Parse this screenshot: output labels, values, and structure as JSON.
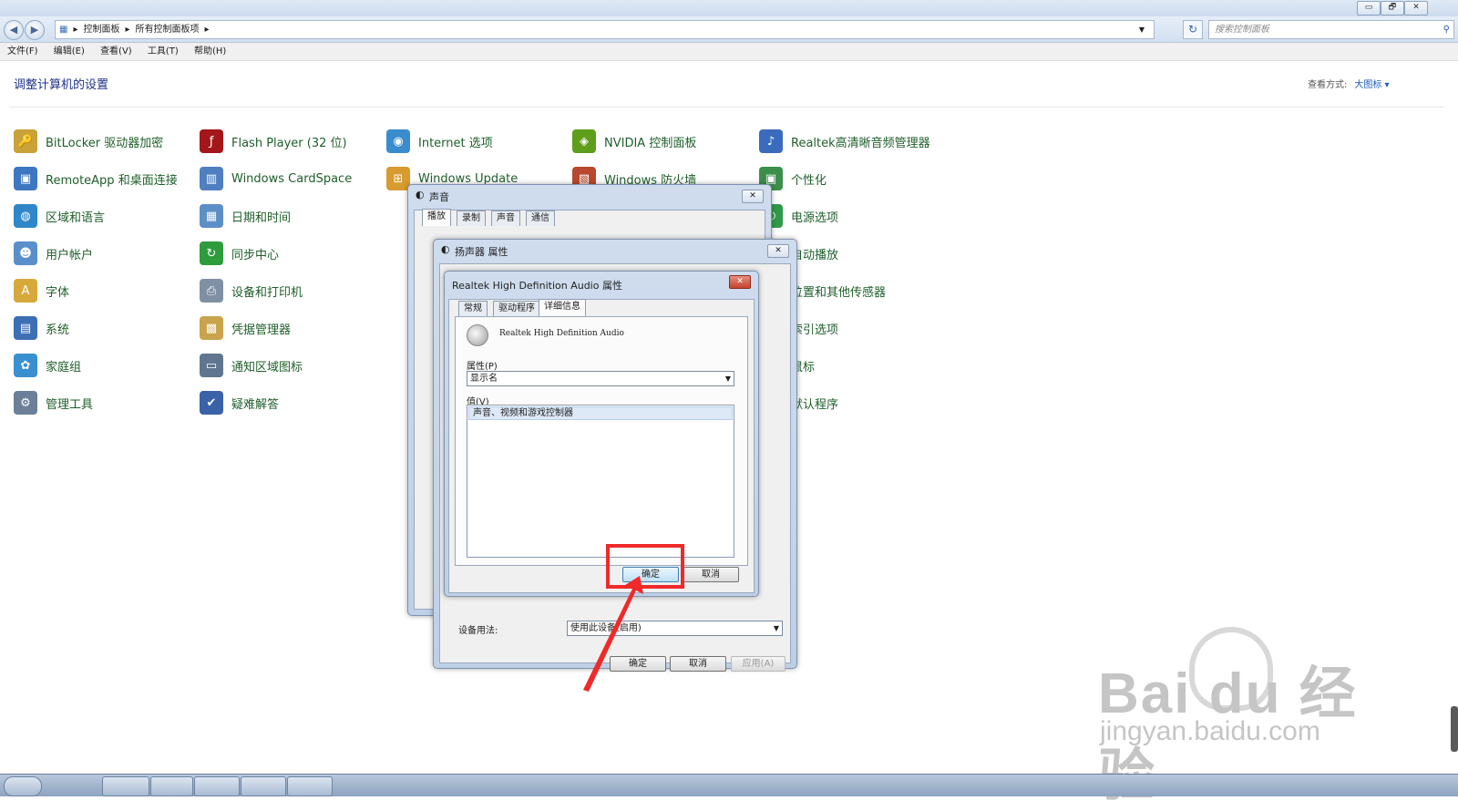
{
  "window": {
    "caption_buttons": [
      "▭",
      "🗗",
      "✕"
    ],
    "breadcrumb": [
      "控制面板",
      "所有控制面板项"
    ],
    "search_placeholder": "搜索控制面板"
  },
  "menu": [
    "文件(F)",
    "编辑(E)",
    "查看(V)",
    "工具(T)",
    "帮助(H)"
  ],
  "content": {
    "heading": "调整计算机的设置",
    "view_label": "查看方式:",
    "view_value": "大图标 ▾",
    "items": [
      {
        "label": "BitLocker 驱动器加密",
        "icon": "key-lock-icon",
        "color": "#c9a23a"
      },
      {
        "label": "RemoteApp 和桌面连接",
        "icon": "remote-desktop-icon",
        "color": "#3d77c2"
      },
      {
        "label": "区域和语言",
        "icon": "globe-clock-icon",
        "color": "#2f86c8"
      },
      {
        "label": "用户帐户",
        "icon": "users-icon",
        "color": "#5b8fc9"
      },
      {
        "label": "字体",
        "icon": "font-folder-icon",
        "color": "#d6a93a"
      },
      {
        "label": "系统",
        "icon": "computer-icon",
        "color": "#3c6fb4"
      },
      {
        "label": "家庭组",
        "icon": "homegroup-icon",
        "color": "#3a8fd1"
      },
      {
        "label": "管理工具",
        "icon": "admin-tools-icon",
        "color": "#6b7f98"
      },
      {
        "label": "Flash Player (32 位)",
        "icon": "flash-icon",
        "color": "#a3171a"
      },
      {
        "label": "Windows CardSpace",
        "icon": "cardspace-icon",
        "color": "#4f7fbf"
      },
      {
        "label": "日期和时间",
        "icon": "calendar-clock-icon",
        "color": "#5d8fc6"
      },
      {
        "label": "同步中心",
        "icon": "sync-icon",
        "color": "#2e9b3c"
      },
      {
        "label": "设备和打印机",
        "icon": "printer-icon",
        "color": "#8090a4"
      },
      {
        "label": "凭据管理器",
        "icon": "vault-icon",
        "color": "#c8a44c"
      },
      {
        "label": "通知区域图标",
        "icon": "tray-icon",
        "color": "#607690"
      },
      {
        "label": "疑难解答",
        "icon": "troubleshoot-icon",
        "color": "#3a62a8"
      },
      {
        "label": "Internet 选项",
        "icon": "internet-globe-icon",
        "color": "#3b8ccc"
      },
      {
        "label": "Windows Update",
        "icon": "windows-update-icon",
        "color": "#d89b2f"
      },
      {
        "label": "NVIDIA 控制面板",
        "icon": "nvidia-icon",
        "color": "#5f9e1a"
      },
      {
        "label": "Windows 防火墙",
        "icon": "firewall-icon",
        "color": "#b8482f"
      },
      {
        "label": "Realtek高清晰音频管理器",
        "icon": "realtek-audio-icon",
        "color": "#3b6bbd"
      },
      {
        "label": "个性化",
        "icon": "personalize-icon",
        "color": "#3b8f4a"
      },
      {
        "label": "电源选项",
        "icon": "power-icon",
        "color": "#2f9a4a"
      },
      {
        "label": "自动播放",
        "icon": "autoplay-icon",
        "color": "#2e8f3a"
      },
      {
        "label": "位置和其他传感器",
        "icon": "sensor-icon",
        "color": "#4e7fb8"
      },
      {
        "label": "索引选项",
        "icon": "index-icon",
        "color": "#6a8bb0"
      },
      {
        "label": "鼠标",
        "icon": "mouse-icon",
        "color": "#7a8aa0"
      },
      {
        "label": "默认程序",
        "icon": "default-programs-icon",
        "color": "#3b86c6"
      }
    ]
  },
  "sound_dialog": {
    "title": "声音",
    "tabs": [
      "播放",
      "录制",
      "声音",
      "通信"
    ]
  },
  "speaker_dialog": {
    "title": "扬声器 属性",
    "device_usage_label": "设备用法:",
    "device_usage_value": "使用此设备(启用)",
    "ok": "确定",
    "cancel": "取消",
    "apply": "应用(A)"
  },
  "realtek_dialog": {
    "title": "Realtek High Definition Audio 属性",
    "tabs": [
      "常规",
      "驱动程序",
      "详细信息"
    ],
    "device_name": "Realtek High Definition Audio",
    "property_label": "属性(P)",
    "property_value": "显示名",
    "value_label": "值(V)",
    "value_item": "声音、视频和游戏控制器",
    "ok": "确定",
    "cancel": "取消"
  },
  "watermark": {
    "brand": "Bai du 经验",
    "url": "jingyan.baidu.com"
  }
}
